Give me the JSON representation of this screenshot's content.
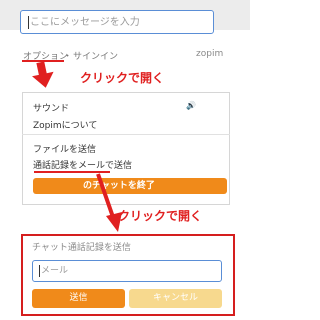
{
  "chat_input": {
    "placeholder": "ここにメッセージを入力"
  },
  "footer": {
    "options": "オプション",
    "separator": "・",
    "signin": "サインイン",
    "brand": "zopim"
  },
  "callouts": {
    "first": "クリックで開く",
    "second": "クリックで開く"
  },
  "menu": {
    "items": [
      "サウンド",
      "Zopimについて",
      "ファイルを送信",
      "通話記録をメールで送信"
    ],
    "end_chat": "のチャットを終了"
  },
  "transcript_panel": {
    "title": "チャット通話記録を送信",
    "email_placeholder": "メール",
    "send": "送信",
    "cancel": "キャンセル"
  },
  "colors": {
    "accent": "#f08a1a",
    "callout_red": "#e02020",
    "input_border": "#5a8ed6",
    "cancel_bg": "#f7d98e"
  }
}
